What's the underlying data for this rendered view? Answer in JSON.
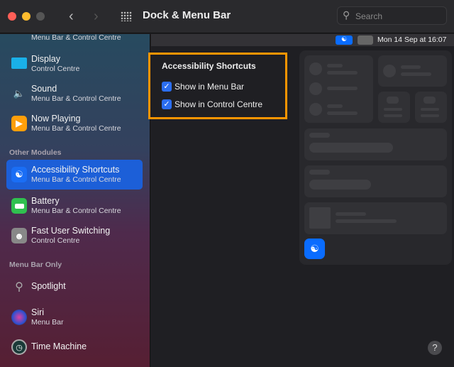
{
  "window": {
    "title": "Dock & Menu Bar",
    "search_placeholder": "Search"
  },
  "menu_bar_preview": {
    "datetime": "Mon 14 Sep at  16:07"
  },
  "sidebar": {
    "partial_item_subtitle": "Menu Bar & Control Centre",
    "items": [
      {
        "label": "Display",
        "subtitle": "Control Centre",
        "color": "#1ab0e8"
      },
      {
        "label": "Sound",
        "subtitle": "Menu Bar & Control Centre",
        "color": "#9aa"
      },
      {
        "label": "Now Playing",
        "subtitle": "Menu Bar & Control Centre",
        "color": "#ff9f0a"
      }
    ],
    "section_other": "Other Modules",
    "other": [
      {
        "label": "Accessibility Shortcuts",
        "subtitle": "Menu Bar & Control Centre",
        "selected": true
      },
      {
        "label": "Battery",
        "subtitle": "Menu Bar & Control Centre"
      },
      {
        "label": "Fast User Switching",
        "subtitle": "Control Centre"
      }
    ],
    "section_menubar": "Menu Bar Only",
    "menubar_only": [
      {
        "label": "Spotlight"
      },
      {
        "label": "Siri",
        "subtitle": "Menu Bar"
      },
      {
        "label": "Time Machine"
      }
    ]
  },
  "settings": {
    "title": "Accessibility Shortcuts",
    "options": [
      {
        "label": "Show in Menu Bar",
        "checked": true
      },
      {
        "label": "Show in Control Centre",
        "checked": true
      }
    ]
  },
  "help": "?",
  "colors": {
    "accent": "#1c5fd8",
    "highlight": "#ff9500"
  }
}
